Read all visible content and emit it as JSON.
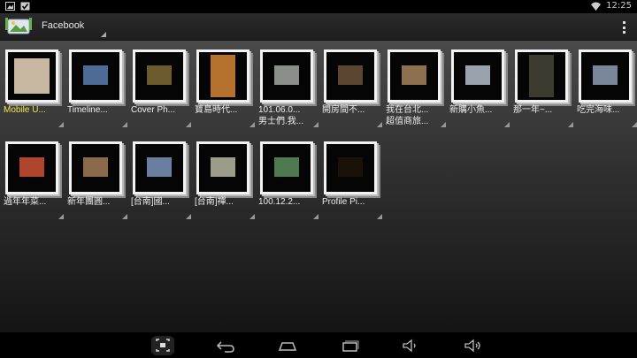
{
  "status_bar": {
    "time": "12:25",
    "left_icons": [
      "gallery-notification-icon",
      "checkbox-notification-icon"
    ],
    "right_icons": [
      "wifi-icon"
    ]
  },
  "action_bar": {
    "title": "Facebook",
    "app_icon": "facebook-album-icon",
    "menu_icon": "overflow-menu-icon"
  },
  "albums": [
    {
      "label_lines": [
        "Mobile U..."
      ],
      "highlighted": true,
      "photo_color": "#c8b7a0"
    },
    {
      "label_lines": [
        "Timeline..."
      ],
      "highlighted": false,
      "photo_color": "#4d6b94"
    },
    {
      "label_lines": [
        "Cover Ph..."
      ],
      "highlighted": false,
      "photo_color": "#6b5a2e"
    },
    {
      "label_lines": [
        "寶島時代..."
      ],
      "highlighted": false,
      "photo_color": "#b5722e"
    },
    {
      "label_lines": [
        "101.06.0...",
        "男士們.我..."
      ],
      "highlighted": false,
      "photo_color": "#8a8f8a"
    },
    {
      "label_lines": [
        "開房間不..."
      ],
      "highlighted": false,
      "photo_color": "#5b4632"
    },
    {
      "label_lines": [
        "我在台北...",
        "超值商旅..."
      ],
      "highlighted": false,
      "photo_color": "#8c7050"
    },
    {
      "label_lines": [
        "新購小魚..."
      ],
      "highlighted": false,
      "photo_color": "#9aa3ad"
    },
    {
      "label_lines": [
        "那一年~..."
      ],
      "highlighted": false,
      "photo_color": "#3d3a30"
    },
    {
      "label_lines": [
        "吃完海味..."
      ],
      "highlighted": false,
      "photo_color": "#7a8699"
    },
    {
      "label_lines": [
        "過年年菜..."
      ],
      "highlighted": false,
      "photo_color": "#b0452e"
    },
    {
      "label_lines": [
        "新年團圓..."
      ],
      "highlighted": false,
      "photo_color": "#8a6a4a"
    },
    {
      "label_lines": [
        "[台南]國..."
      ],
      "highlighted": false,
      "photo_color": "#6a7fa0"
    },
    {
      "label_lines": [
        "[台南]禪..."
      ],
      "highlighted": false,
      "photo_color": "#9c9c8a"
    },
    {
      "label_lines": [
        "100.12.2..."
      ],
      "highlighted": false,
      "photo_color": "#4f7a4f"
    },
    {
      "label_lines": [
        "Profile Pi..."
      ],
      "highlighted": false,
      "photo_color": "#1a1208"
    }
  ],
  "nav_bar": {
    "buttons": [
      "screenshot-icon",
      "back-icon",
      "home-icon",
      "recent-apps-icon",
      "volume-down-icon",
      "volume-up-icon"
    ]
  }
}
